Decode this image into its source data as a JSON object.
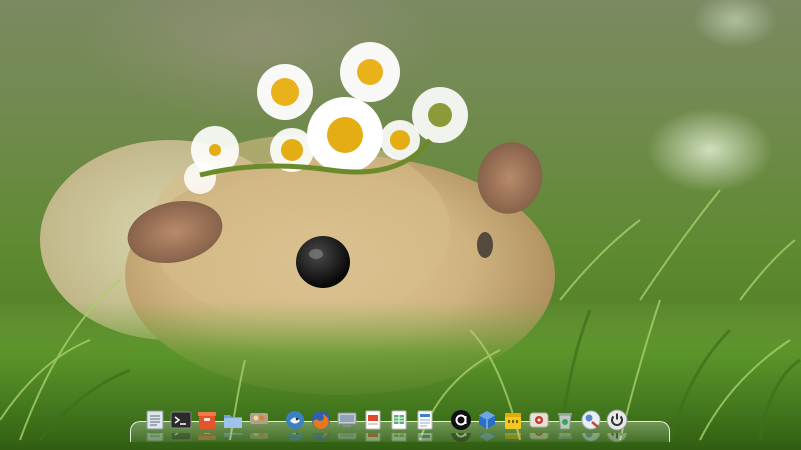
{
  "desktop": {
    "wallpaper": "guinea-pig-with-daisy-crown",
    "colors": {
      "grass_dark": "#3e6a18",
      "grass_light": "#7fb04a",
      "fur": "#d8c094",
      "daisy_petal": "#ffffff",
      "daisy_center": "#e9b21a"
    }
  },
  "dock": {
    "items": [
      {
        "name": "text-editor",
        "icon": "text-editor-icon",
        "color": "#dfe6ee"
      },
      {
        "name": "terminal",
        "icon": "terminal-icon",
        "color": "#2b2b2b"
      },
      {
        "name": "package-installer",
        "icon": "package-icon",
        "color": "#e2552a"
      },
      {
        "name": "file-manager",
        "icon": "folder-icon",
        "color": "#6fa3d8"
      },
      {
        "name": "system-monitor",
        "icon": "monitor-icon",
        "color": "#b0a18a"
      },
      {
        "name": "pidgin",
        "icon": "chat-bird-icon",
        "color": "#7a4fb0"
      },
      {
        "name": "firefox",
        "icon": "firefox-icon",
        "color": "#e6781e"
      },
      {
        "name": "display-settings",
        "icon": "display-icon",
        "color": "#8a8f96"
      },
      {
        "name": "presentation",
        "icon": "presentation-icon",
        "color": "#e04a2b"
      },
      {
        "name": "spreadsheet",
        "icon": "spreadsheet-icon",
        "color": "#3aa655"
      },
      {
        "name": "document",
        "icon": "document-icon",
        "color": "#3b7fd6"
      },
      {
        "name": "amazon",
        "icon": "amazon-icon",
        "color": "#111111"
      },
      {
        "name": "virtualbox",
        "icon": "cube-icon",
        "color": "#2c6fc6"
      },
      {
        "name": "archive",
        "icon": "archive-icon",
        "color": "#f2c81f"
      },
      {
        "name": "games",
        "icon": "games-icon",
        "color": "#c23a2c"
      },
      {
        "name": "trash",
        "icon": "trash-icon",
        "color": "#bfc7c2"
      },
      {
        "name": "settings",
        "icon": "settings-icon",
        "color": "#9fb4c8"
      },
      {
        "name": "power",
        "icon": "power-icon",
        "color": "#e8e8e8"
      }
    ]
  }
}
